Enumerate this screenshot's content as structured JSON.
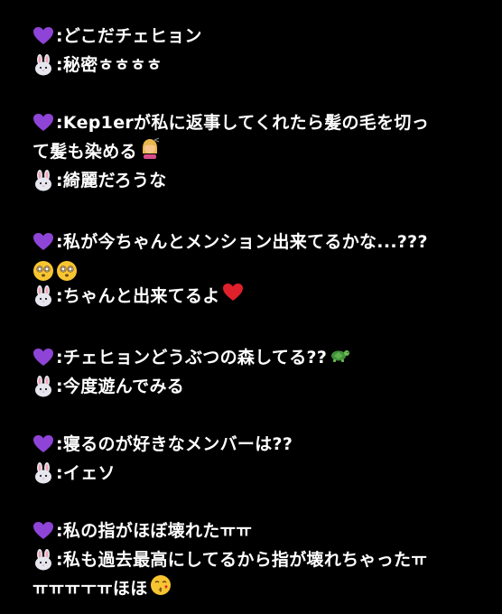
{
  "conversation": [
    {
      "lines": [
        {
          "speaker": "heart",
          "text": ":どこだチェヒョン"
        },
        {
          "speaker": "rabbit",
          "text": ":秘密ㅎㅎㅎㅎ"
        }
      ]
    },
    {
      "lines": [
        {
          "speaker": "heart",
          "text": ":Kep1erが私に返事してくれたら髪の毛を切っ"
        },
        {
          "speaker": "none",
          "text": "て髪も染める",
          "trailing_emoji": "haircut-emoji"
        },
        {
          "speaker": "rabbit",
          "text": ":綺麗だろうな"
        }
      ]
    },
    {
      "lines": [
        {
          "speaker": "heart",
          "text": ":私が今ちゃんとメンション出来てるかな...???"
        },
        {
          "speaker": "none",
          "text": "",
          "trailing_emoji": "dizzy-face-emoji-x2"
        },
        {
          "speaker": "rabbit",
          "text": ":ちゃんと出来てるよ",
          "trailing_emoji": "red-heart-emoji"
        }
      ]
    },
    {
      "lines": [
        {
          "speaker": "heart",
          "text": ":チェヒョンどうぶつの森してる??",
          "trailing_emoji": "turtle-emoji"
        },
        {
          "speaker": "rabbit",
          "text": ":今度遊んでみる"
        }
      ]
    },
    {
      "lines": [
        {
          "speaker": "heart",
          "text": ":寝るのが好きなメンバーは??"
        },
        {
          "speaker": "rabbit",
          "text": ":イェソ"
        }
      ]
    },
    {
      "lines": [
        {
          "speaker": "heart",
          "text": ":私の指がほぼ壊れたㅠㅠ"
        },
        {
          "speaker": "rabbit",
          "text": ":私も過去最高にしてるから指が壊れちゃったㅠ"
        },
        {
          "speaker": "none",
          "text": "ㅠㅠㅠㅜㅠほほ",
          "trailing_emoji": "kissing-face-emoji"
        }
      ]
    }
  ],
  "colors": {
    "background": "#000000",
    "text": "#ffffff",
    "heart": "#8e44d6",
    "rabbit_fur": "#e6e6ee",
    "rabbit_ear_inner": "#f2a6b8",
    "red_heart": "#e0202a",
    "turtle": "#3f8f3a",
    "emoji_face": "#f7c531"
  }
}
